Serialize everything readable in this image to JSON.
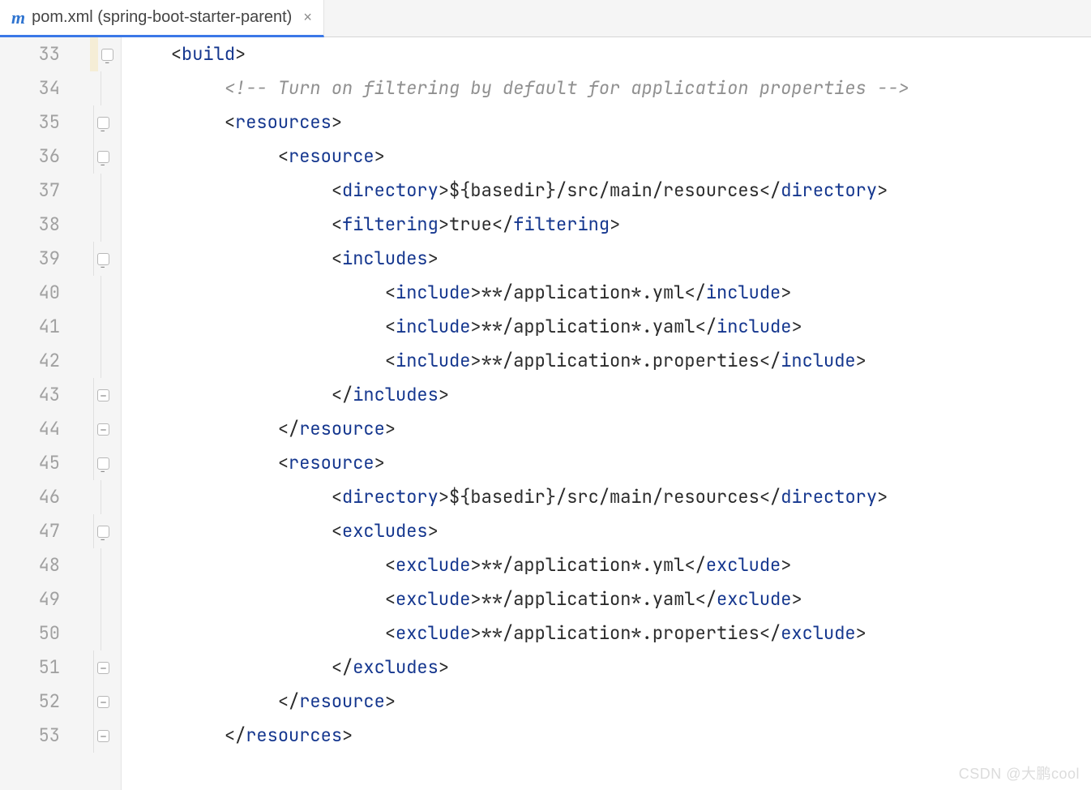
{
  "tab": {
    "icon": "m",
    "title": "pom.xml (spring-boot-starter-parent)",
    "close": "×"
  },
  "lines": {
    "start": 33,
    "end": 53
  },
  "code": [
    {
      "n": 33,
      "fold": "open",
      "hl": true,
      "indent": 0,
      "tokens": [
        {
          "c": "brkt",
          "v": "<"
        },
        {
          "c": "tag",
          "v": "build"
        },
        {
          "c": "brkt",
          "v": ">"
        }
      ]
    },
    {
      "n": 34,
      "fold": "line",
      "indent": 1,
      "tokens": [
        {
          "c": "cmt",
          "v": "<!-- Turn on filtering by default for application properties -->"
        }
      ]
    },
    {
      "n": 35,
      "fold": "open",
      "indent": 1,
      "tokens": [
        {
          "c": "brkt",
          "v": "<"
        },
        {
          "c": "tag",
          "v": "resources"
        },
        {
          "c": "brkt",
          "v": ">"
        }
      ]
    },
    {
      "n": 36,
      "fold": "open",
      "indent": 2,
      "tokens": [
        {
          "c": "brkt",
          "v": "<"
        },
        {
          "c": "tag",
          "v": "resource"
        },
        {
          "c": "brkt",
          "v": ">"
        }
      ]
    },
    {
      "n": 37,
      "fold": "line",
      "indent": 3,
      "tokens": [
        {
          "c": "brkt",
          "v": "<"
        },
        {
          "c": "tag",
          "v": "directory"
        },
        {
          "c": "brkt",
          "v": ">"
        },
        {
          "c": "text",
          "v": "${basedir}/src/main/resources"
        },
        {
          "c": "brkt",
          "v": "</"
        },
        {
          "c": "tag",
          "v": "directory"
        },
        {
          "c": "brkt",
          "v": ">"
        }
      ]
    },
    {
      "n": 38,
      "fold": "line",
      "indent": 3,
      "tokens": [
        {
          "c": "brkt",
          "v": "<"
        },
        {
          "c": "tag",
          "v": "filtering"
        },
        {
          "c": "brkt",
          "v": ">"
        },
        {
          "c": "text",
          "v": "true"
        },
        {
          "c": "brkt",
          "v": "</"
        },
        {
          "c": "tag",
          "v": "filtering"
        },
        {
          "c": "brkt",
          "v": ">"
        }
      ]
    },
    {
      "n": 39,
      "fold": "open",
      "indent": 3,
      "tokens": [
        {
          "c": "brkt",
          "v": "<"
        },
        {
          "c": "tag",
          "v": "includes"
        },
        {
          "c": "brkt",
          "v": ">"
        }
      ]
    },
    {
      "n": 40,
      "fold": "line",
      "indent": 4,
      "tokens": [
        {
          "c": "brkt",
          "v": "<"
        },
        {
          "c": "tag",
          "v": "include"
        },
        {
          "c": "brkt",
          "v": ">"
        },
        {
          "c": "text",
          "v": "**/application*.yml"
        },
        {
          "c": "brkt",
          "v": "</"
        },
        {
          "c": "tag",
          "v": "include"
        },
        {
          "c": "brkt",
          "v": ">"
        }
      ]
    },
    {
      "n": 41,
      "fold": "line",
      "indent": 4,
      "tokens": [
        {
          "c": "brkt",
          "v": "<"
        },
        {
          "c": "tag",
          "v": "include"
        },
        {
          "c": "brkt",
          "v": ">"
        },
        {
          "c": "text",
          "v": "**/application*.yaml"
        },
        {
          "c": "brkt",
          "v": "</"
        },
        {
          "c": "tag",
          "v": "include"
        },
        {
          "c": "brkt",
          "v": ">"
        }
      ]
    },
    {
      "n": 42,
      "fold": "line",
      "indent": 4,
      "tokens": [
        {
          "c": "brkt",
          "v": "<"
        },
        {
          "c": "tag",
          "v": "include"
        },
        {
          "c": "brkt",
          "v": ">"
        },
        {
          "c": "text",
          "v": "**/application*.properties"
        },
        {
          "c": "brkt",
          "v": "</"
        },
        {
          "c": "tag",
          "v": "include"
        },
        {
          "c": "brkt",
          "v": ">"
        }
      ]
    },
    {
      "n": 43,
      "fold": "close",
      "indent": 3,
      "tokens": [
        {
          "c": "brkt",
          "v": "</"
        },
        {
          "c": "tag",
          "v": "includes"
        },
        {
          "c": "brkt",
          "v": ">"
        }
      ]
    },
    {
      "n": 44,
      "fold": "close",
      "indent": 2,
      "tokens": [
        {
          "c": "brkt",
          "v": "</"
        },
        {
          "c": "tag",
          "v": "resource"
        },
        {
          "c": "brkt",
          "v": ">"
        }
      ]
    },
    {
      "n": 45,
      "fold": "open",
      "indent": 2,
      "tokens": [
        {
          "c": "brkt",
          "v": "<"
        },
        {
          "c": "tag",
          "v": "resource"
        },
        {
          "c": "brkt",
          "v": ">"
        }
      ]
    },
    {
      "n": 46,
      "fold": "line",
      "indent": 3,
      "tokens": [
        {
          "c": "brkt",
          "v": "<"
        },
        {
          "c": "tag",
          "v": "directory"
        },
        {
          "c": "brkt",
          "v": ">"
        },
        {
          "c": "text",
          "v": "${basedir}/src/main/resources"
        },
        {
          "c": "brkt",
          "v": "</"
        },
        {
          "c": "tag",
          "v": "directory"
        },
        {
          "c": "brkt",
          "v": ">"
        }
      ]
    },
    {
      "n": 47,
      "fold": "open",
      "indent": 3,
      "tokens": [
        {
          "c": "brkt",
          "v": "<"
        },
        {
          "c": "tag",
          "v": "excludes"
        },
        {
          "c": "brkt",
          "v": ">"
        }
      ]
    },
    {
      "n": 48,
      "fold": "line",
      "indent": 4,
      "tokens": [
        {
          "c": "brkt",
          "v": "<"
        },
        {
          "c": "tag",
          "v": "exclude"
        },
        {
          "c": "brkt",
          "v": ">"
        },
        {
          "c": "text",
          "v": "**/application*.yml"
        },
        {
          "c": "brkt",
          "v": "</"
        },
        {
          "c": "tag",
          "v": "exclude"
        },
        {
          "c": "brkt",
          "v": ">"
        }
      ]
    },
    {
      "n": 49,
      "fold": "line",
      "indent": 4,
      "tokens": [
        {
          "c": "brkt",
          "v": "<"
        },
        {
          "c": "tag",
          "v": "exclude"
        },
        {
          "c": "brkt",
          "v": ">"
        },
        {
          "c": "text",
          "v": "**/application*.yaml"
        },
        {
          "c": "brkt",
          "v": "</"
        },
        {
          "c": "tag",
          "v": "exclude"
        },
        {
          "c": "brkt",
          "v": ">"
        }
      ]
    },
    {
      "n": 50,
      "fold": "line",
      "indent": 4,
      "tokens": [
        {
          "c": "brkt",
          "v": "<"
        },
        {
          "c": "tag",
          "v": "exclude"
        },
        {
          "c": "brkt",
          "v": ">"
        },
        {
          "c": "text",
          "v": "**/application*.properties"
        },
        {
          "c": "brkt",
          "v": "</"
        },
        {
          "c": "tag",
          "v": "exclude"
        },
        {
          "c": "brkt",
          "v": ">"
        }
      ]
    },
    {
      "n": 51,
      "fold": "close",
      "indent": 3,
      "tokens": [
        {
          "c": "brkt",
          "v": "</"
        },
        {
          "c": "tag",
          "v": "excludes"
        },
        {
          "c": "brkt",
          "v": ">"
        }
      ]
    },
    {
      "n": 52,
      "fold": "close",
      "indent": 2,
      "tokens": [
        {
          "c": "brkt",
          "v": "</"
        },
        {
          "c": "tag",
          "v": "resource"
        },
        {
          "c": "brkt",
          "v": ">"
        }
      ]
    },
    {
      "n": 53,
      "fold": "close",
      "indent": 1,
      "tokens": [
        {
          "c": "brkt",
          "v": "</"
        },
        {
          "c": "tag",
          "v": "resources"
        },
        {
          "c": "brkt",
          "v": ">"
        }
      ]
    }
  ],
  "watermark": "CSDN @大鹏cool"
}
